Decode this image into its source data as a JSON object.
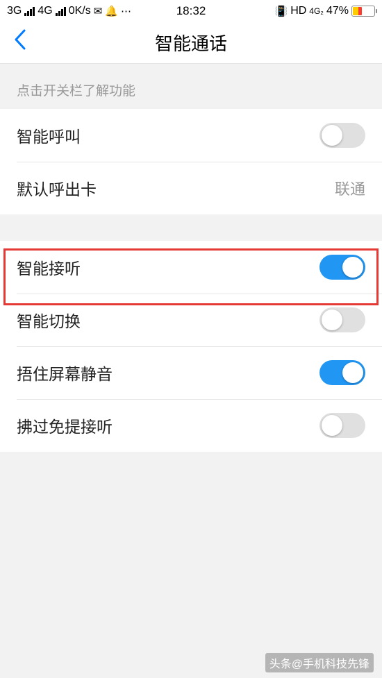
{
  "status": {
    "net1": "3G",
    "net2": "4G",
    "speed": "0K/s",
    "time": "18:32",
    "hd": "HD",
    "net_sub": "4G₂",
    "battery_pct": "47%"
  },
  "nav": {
    "title": "智能通话"
  },
  "section1": {
    "header": "点击开关栏了解功能",
    "rows": [
      {
        "label": "智能呼叫",
        "type": "toggle",
        "on": false
      },
      {
        "label": "默认呼出卡",
        "type": "value",
        "value": "联通"
      }
    ]
  },
  "section2": {
    "rows": [
      {
        "label": "智能接听",
        "type": "toggle",
        "on": true,
        "highlight": true
      },
      {
        "label": "智能切换",
        "type": "toggle",
        "on": false
      },
      {
        "label": "捂住屏幕静音",
        "type": "toggle",
        "on": true
      },
      {
        "label": "拂过免提接听",
        "type": "toggle",
        "on": false
      }
    ]
  },
  "watermark": "头条@手机科技先锋"
}
